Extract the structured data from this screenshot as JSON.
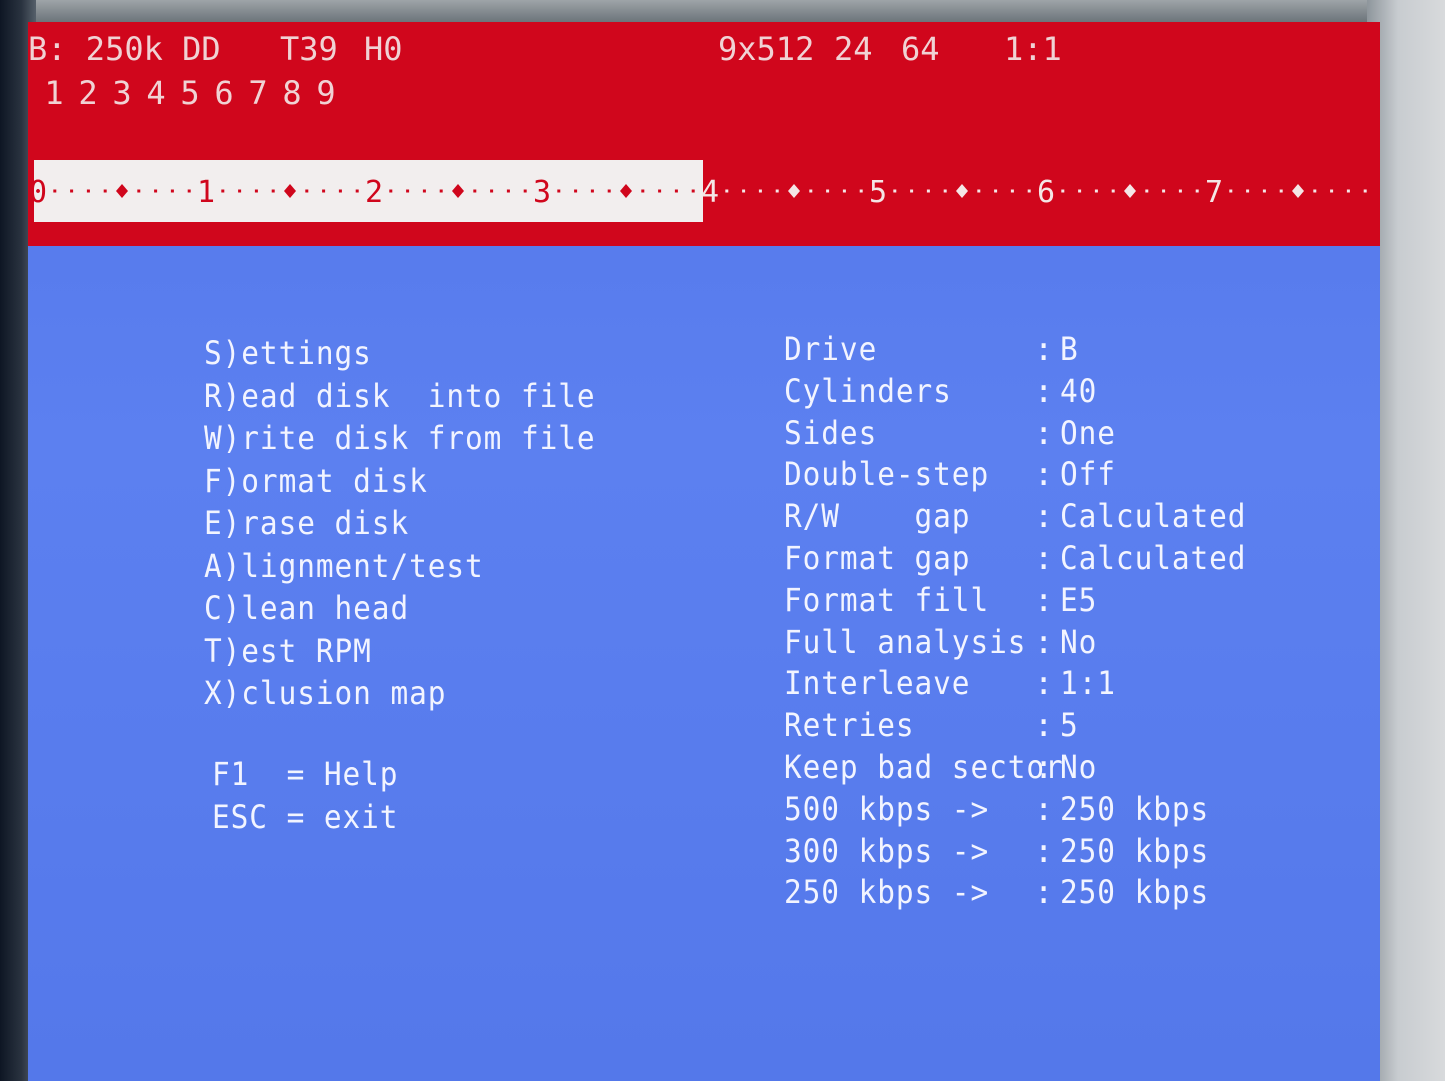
{
  "header": {
    "drive_info": "B: 250k DD",
    "track": "T39",
    "head": "H0",
    "geometry": "9x512",
    "field_a": "24",
    "field_b": "64",
    "interleave": "1:1",
    "sectors": [
      "1",
      "2",
      "3",
      "4",
      "5",
      "6",
      "7",
      "8",
      "9"
    ]
  },
  "track_bar": {
    "labels": [
      "0",
      "1",
      "2",
      "3",
      "4",
      "5",
      "6",
      "7"
    ],
    "progress_fraction": 0.495,
    "fill_color": "#f2eeee",
    "mark_color": "#d0061c"
  },
  "menu": {
    "items": [
      "S)ettings",
      "R)ead disk  into file",
      "W)rite disk from file",
      "F)ormat disk",
      "E)rase disk",
      "A)lignment/test",
      "C)lean head",
      "T)est RPM",
      "X)clusion map"
    ],
    "help": [
      "F1  = Help",
      "ESC = exit"
    ]
  },
  "settings": [
    {
      "label": "Drive",
      "value": "B"
    },
    {
      "label": "Cylinders",
      "value": "40"
    },
    {
      "label": "Sides",
      "value": "One"
    },
    {
      "label": "Double-step",
      "value": "Off"
    },
    {
      "label": "R/W    gap",
      "value": "Calculated"
    },
    {
      "label": "Format gap",
      "value": "Calculated"
    },
    {
      "label": "Format fill",
      "value": "E5"
    },
    {
      "label": "Full analysis",
      "value": "No"
    },
    {
      "label": "Interleave",
      "value": "1:1"
    },
    {
      "label": "Retries",
      "value": "5"
    },
    {
      "label": "Keep bad sector",
      "value": "No"
    },
    {
      "label": "500 kbps ->",
      "value": "250 kbps"
    },
    {
      "label": "300 kbps ->",
      "value": "250 kbps"
    },
    {
      "label": "250 kbps ->",
      "value": "250 kbps"
    }
  ],
  "separator": ":",
  "colors": {
    "header_bg": "#d0061c",
    "screen_bg": "#5a7ef0",
    "text": "#f2f4ff"
  }
}
